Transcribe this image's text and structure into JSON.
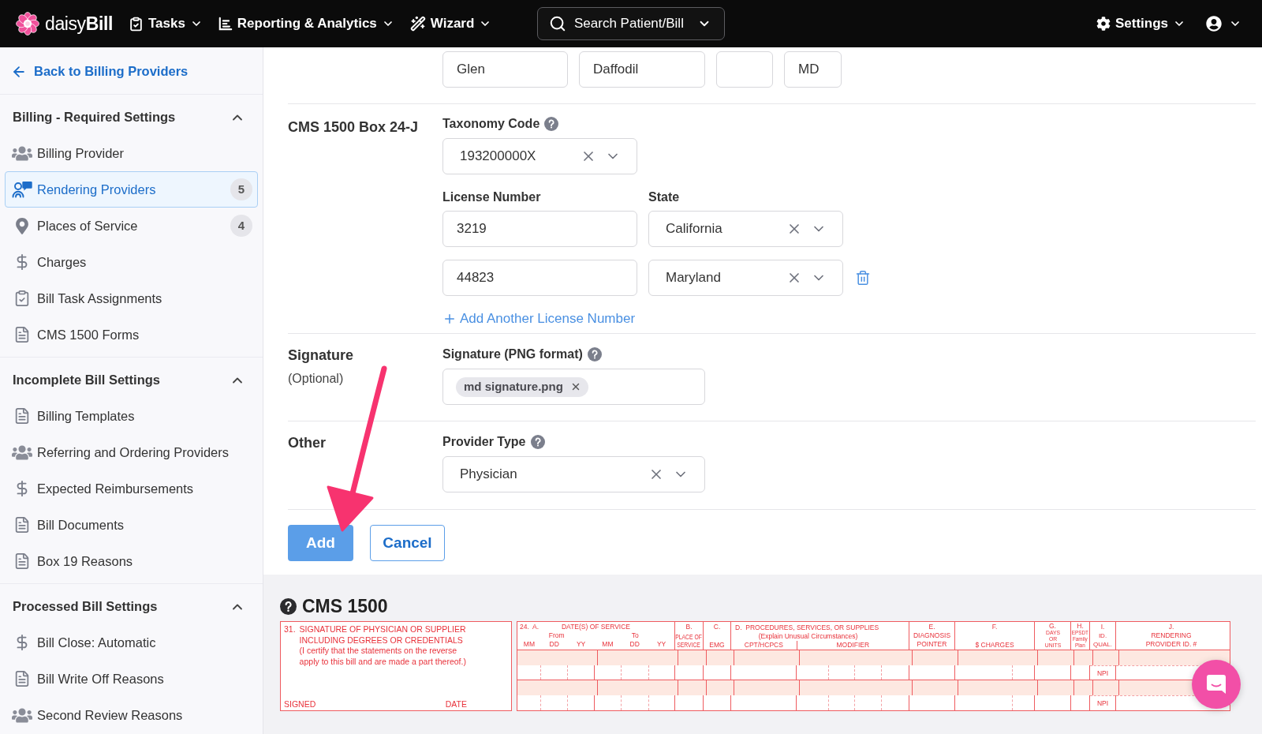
{
  "top_bar": {
    "logo": "daisy**Bill**",
    "nav": [
      {
        "label": "Tasks",
        "kind": "tasks"
      },
      {
        "label": "Reporting & Analytics",
        "kind": "reports"
      },
      {
        "label": "Wizard",
        "kind": "wizard"
      }
    ],
    "search": {
      "label": "Search Patient/Bill"
    },
    "settings": {
      "label": "Settings"
    }
  },
  "sidebar": {
    "back_link": "Back to Billing Providers",
    "sections": [
      {
        "title": "Billing - Required Settings",
        "expanded": true,
        "items": [
          {
            "label": "Billing Provider",
            "kind": "group",
            "selected": false
          },
          {
            "label": "Rendering Providers",
            "kind": "provider",
            "selected": true,
            "count": "5"
          },
          {
            "label": "Places of Service",
            "kind": "location",
            "selected": false,
            "count": "4"
          },
          {
            "label": "Charges",
            "kind": "money",
            "selected": false
          },
          {
            "label": "Bill Task Assignments",
            "kind": "task",
            "selected": false
          },
          {
            "label": "CMS 1500 Forms",
            "kind": "document",
            "selected": false
          }
        ]
      },
      {
        "title": "Incomplete Bill Settings",
        "expanded": true,
        "items": [
          {
            "label": "Billing Templates",
            "kind": "document",
            "selected": false
          },
          {
            "label": "Referring and Ordering Providers",
            "kind": "group",
            "selected": false
          },
          {
            "label": "Expected Reimbursements",
            "kind": "money",
            "selected": false
          },
          {
            "label": "Bill Documents",
            "kind": "document",
            "selected": false
          },
          {
            "label": "Box 19 Reasons",
            "kind": "document",
            "selected": false
          }
        ]
      },
      {
        "title": "Processed Bill Settings",
        "expanded": true,
        "items": [
          {
            "label": "Bill Close: Automatic",
            "kind": "money",
            "selected": false
          },
          {
            "label": "Bill Write Off Reasons",
            "kind": "document",
            "selected": false
          },
          {
            "label": "Second Review Reasons",
            "kind": "group",
            "selected": false
          }
        ]
      }
    ]
  },
  "form": {
    "name_fields": [
      {
        "kind": "wide",
        "value": "Glen"
      },
      {
        "kind": "wide",
        "value": "Daffodil"
      },
      {
        "kind": "narrow"
      },
      {
        "kind": "narrow",
        "value": "MD"
      }
    ],
    "box_24j": {
      "title": "CMS 1500 Box 24-J",
      "taxonomy": {
        "label": "Taxonomy Code",
        "help": true,
        "value": "193200000X"
      },
      "license_label": {
        "label": "License Number",
        "help": false
      },
      "state_label": {
        "label": "State",
        "help": false
      },
      "licenses": [
        {
          "number": "3219",
          "state": "California",
          "removable": false
        },
        {
          "number": "44823",
          "state": "Maryland",
          "removable": true
        }
      ],
      "add_link": "Add Another License Number"
    },
    "signature": {
      "title": "Signature",
      "note": "(Optional)",
      "field": {
        "label": "Signature (PNG format)",
        "help": true
      },
      "file": "md signature.png"
    },
    "other": {
      "title": "Other",
      "field": {
        "label": "Provider Type",
        "help": true,
        "value": "Physician"
      }
    },
    "buttons": [
      {
        "label": "Add",
        "kind": "primary"
      },
      {
        "label": "Cancel",
        "kind": "secondary"
      }
    ]
  },
  "cms_1500": {
    "title": "CMS 1500",
    "box_31": {
      "number": "31.",
      "heading": "SIGNATURE OF PHYSICIAN OR SUPPLIER\nINCLUDING DEGREES OR CREDENTIALS",
      "note": "(I certify that the statements on the reverse\napply to this bill and are made a part thereof.)",
      "signed": "SIGNED",
      "date": "DATE"
    },
    "table": {
      "dates": {
        "number": "24.  A.",
        "title": "DATE(S) OF SERVICE",
        "from": "From",
        "to": "To",
        "parts": [
          "MM",
          "DD",
          "YY",
          "MM",
          "DD",
          "YY"
        ]
      },
      "columns": [
        {
          "kind": "simple",
          "letter": "B.",
          "label": "PLACE OF\nSERVICE"
        },
        {
          "kind": "simple",
          "letter": "C.",
          "label": "EMG"
        },
        {
          "kind": "procedures",
          "title": "D.  PROCEDURES, SERVICES, OR SUPPLIES",
          "note": "(Explain Unusual Circumstances)",
          "code": "CPT/HCPCS",
          "modifier": "MODIFIER"
        },
        {
          "kind": "simple",
          "letter": "E.",
          "label": "DIAGNOSIS\nPOINTER"
        },
        {
          "kind": "simple",
          "letter": "F.",
          "label": "$ CHARGES"
        },
        {
          "kind": "simple",
          "letter": "G.",
          "label": "DAYS\nOR\nUNITS"
        },
        {
          "kind": "simple",
          "letter": "H.",
          "label": "EPSDT\nFamily\nPlan"
        },
        {
          "kind": "simple",
          "letter": "I.",
          "label": "ID.\nQUAL."
        },
        {
          "kind": "simple",
          "letter": "J.",
          "label": "RENDERING\nPROVIDER ID. #"
        }
      ],
      "lines": [
        {
          "qualifier": "NPI"
        },
        {
          "qualifier": "NPI"
        }
      ]
    }
  }
}
